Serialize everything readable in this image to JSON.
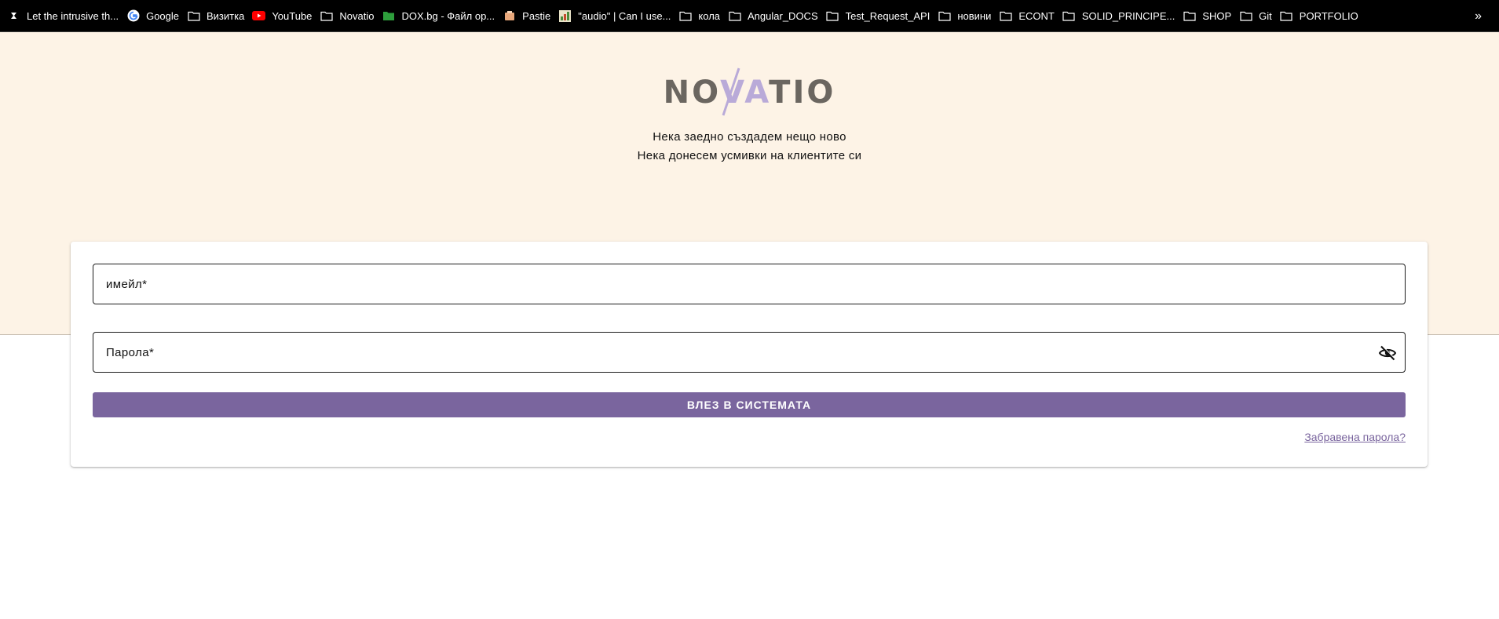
{
  "bookmarks": [
    {
      "label": "Let the intrusive th...",
      "icon": "pearl-icon"
    },
    {
      "label": "Google",
      "icon": "google-icon"
    },
    {
      "label": "Визитка",
      "icon": "folder-icon"
    },
    {
      "label": "YouTube",
      "icon": "youtube-icon"
    },
    {
      "label": "Novatio",
      "icon": "folder-icon"
    },
    {
      "label": "DOX.bg - Файл ор...",
      "icon": "dox-folder-icon"
    },
    {
      "label": "Pastie",
      "icon": "pastie-icon"
    },
    {
      "label": "\"audio\" | Can I use...",
      "icon": "caniuse-icon"
    },
    {
      "label": "кола",
      "icon": "folder-icon"
    },
    {
      "label": "Angular_DOCS",
      "icon": "folder-icon"
    },
    {
      "label": "Test_Request_API",
      "icon": "folder-icon"
    },
    {
      "label": "новини",
      "icon": "folder-icon"
    },
    {
      "label": "ECONT",
      "icon": "folder-icon"
    },
    {
      "label": "SOLID_PRINCIPE...",
      "icon": "folder-icon"
    },
    {
      "label": "SHOP",
      "icon": "folder-icon"
    },
    {
      "label": "Git",
      "icon": "folder-icon"
    },
    {
      "label": "PORTFOLIO",
      "icon": "folder-icon"
    }
  ],
  "bookmarks_more": "»",
  "brand": {
    "logo_text_left": "NO",
    "logo_text_mid": "VA",
    "logo_text_right": "TIO",
    "tagline_1": "Нека заедно създадем нещо ново",
    "tagline_2": "Нека донесем усмивки на клиентите си"
  },
  "login": {
    "email_label": "имейл*",
    "password_label": "Парола*",
    "submit_label": "ВЛЕЗ В СИСТЕМАТА",
    "forgot_label": "Забравена парола?"
  },
  "colors": {
    "hero_bg": "#fdf3e6",
    "accent": "#7a659e",
    "logo_gray": "#6b6660",
    "logo_lavender": "#b9aad8"
  }
}
